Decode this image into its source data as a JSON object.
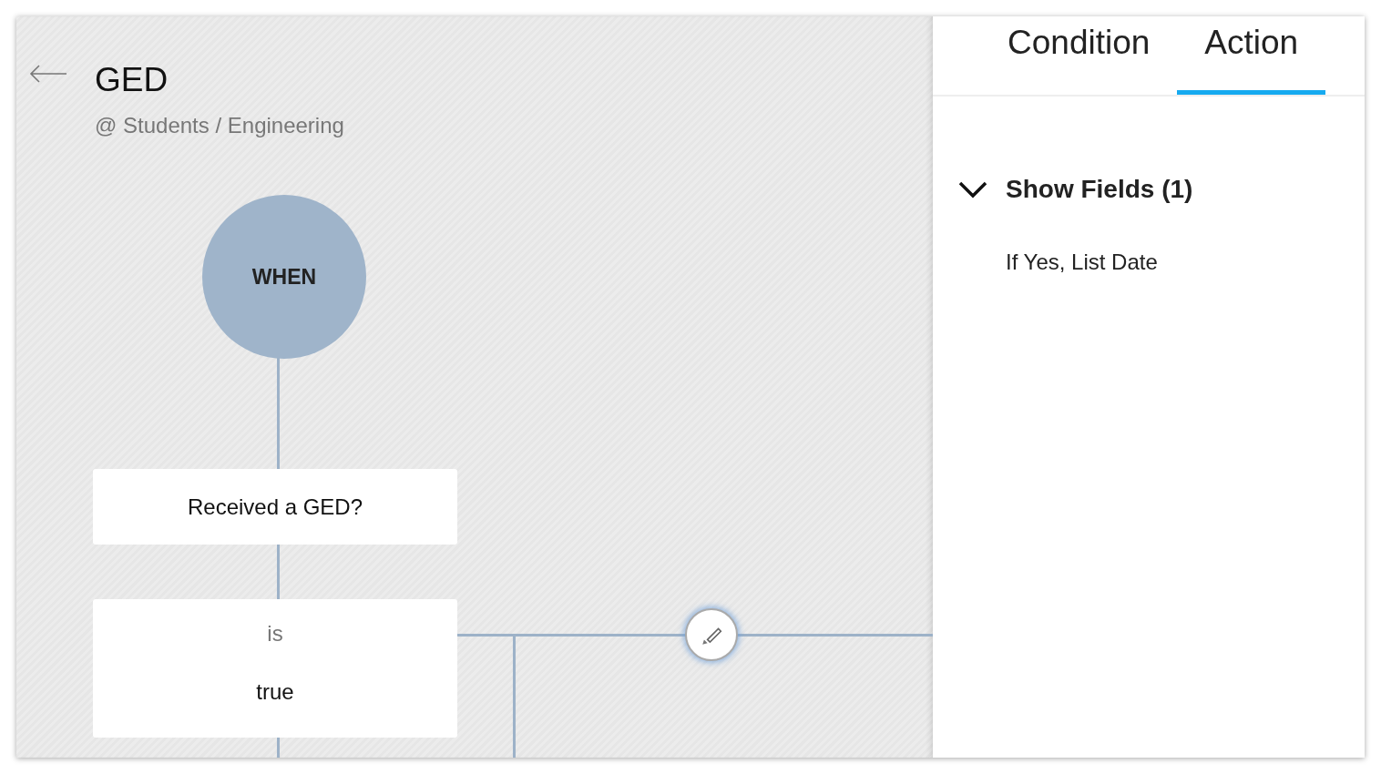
{
  "header": {
    "title": "GED",
    "breadcrumb": "@ Students / Engineering"
  },
  "flow": {
    "start": "WHEN",
    "field": "Received a GED?",
    "operator": "is",
    "value": "true"
  },
  "tabs": [
    {
      "label": "Condition",
      "selected": false
    },
    {
      "label": "Action",
      "selected": true
    }
  ],
  "section": {
    "title": "Show Fields (1)",
    "expanded": true,
    "items": [
      "If Yes, List Date"
    ]
  }
}
